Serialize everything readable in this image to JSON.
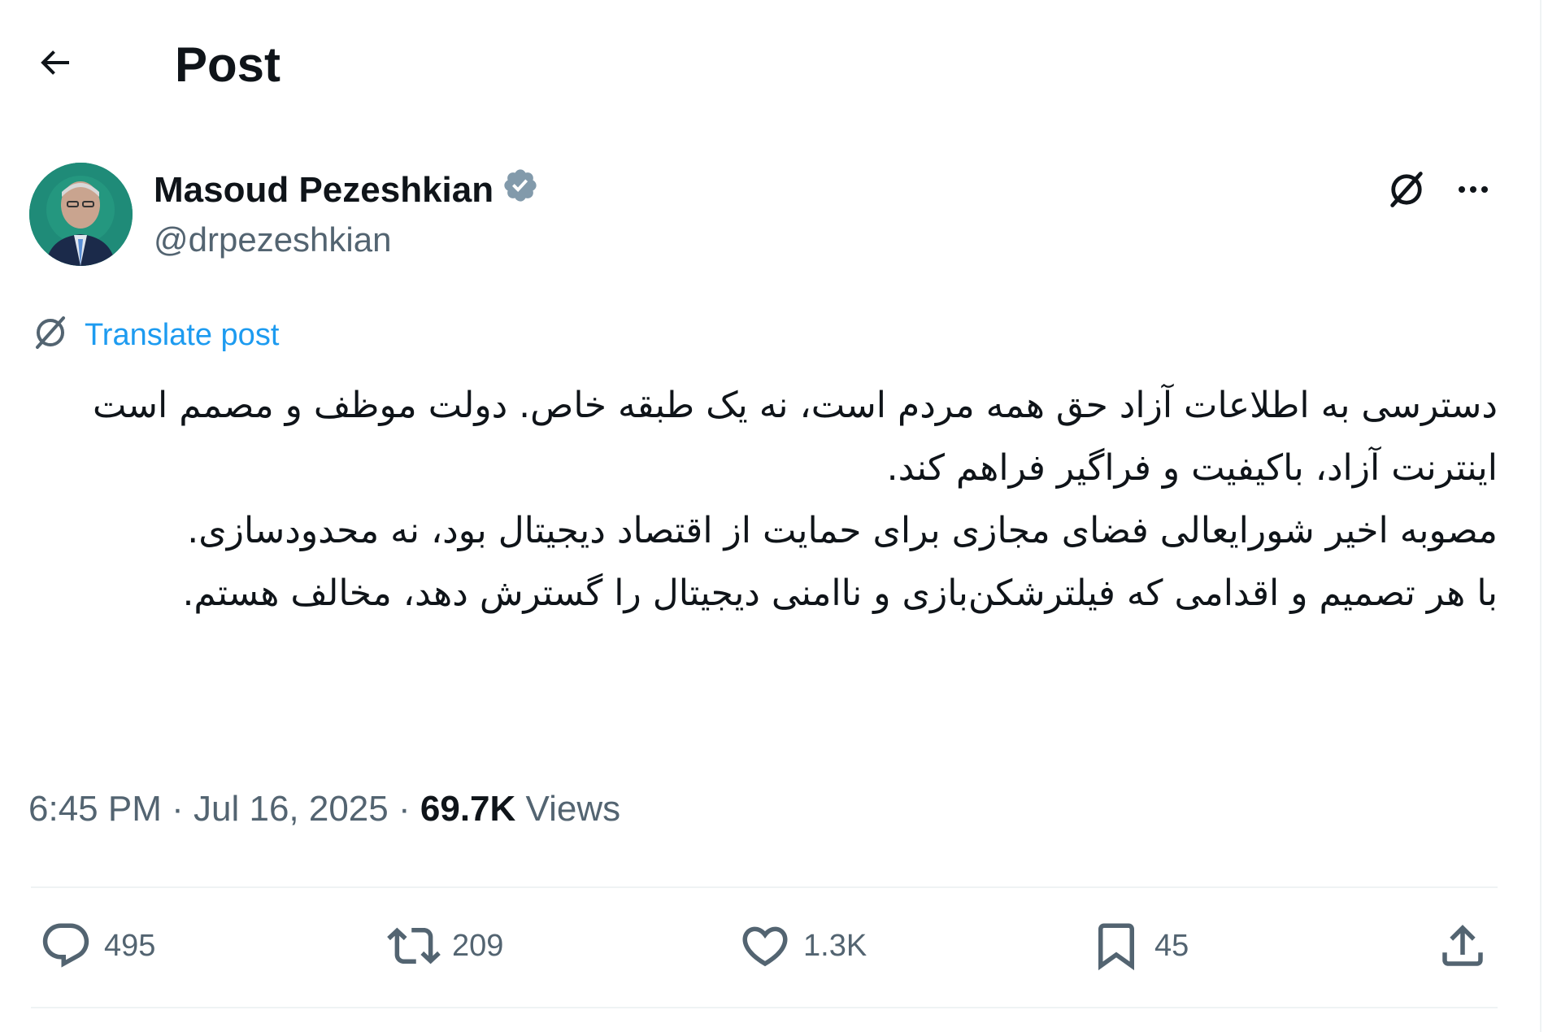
{
  "header": {
    "back_icon": "arrow-left-icon",
    "title": "Post"
  },
  "author": {
    "display_name": "Masoud Pezeshkian",
    "verified_icon": "verified-badge-icon",
    "verified_color": "#829aab",
    "handle": "@drpezeshkian"
  },
  "top_actions": {
    "grok_icon": "grok-icon",
    "more_icon": "more-horizontal-icon"
  },
  "translate": {
    "icon": "grok-icon",
    "label": "Translate post",
    "color": "#1d9bf0"
  },
  "post": {
    "paragraphs": [
      "دسترسی به اطلاعات آزاد حق همه مردم است، نه یک طبقه خاص. دولت موظف و مصمم است اینترنت آزاد، باکیفیت و فراگیر فراهم کند.",
      "مصوبه اخیر شورایعالی فضای مجازی برای حمایت از اقتصاد دیجیتال بود، نه محدودسازی.",
      "با هر تصمیم و اقدامی که فیلترشکن‌بازی و ناامنی دیجیتال را گسترش دهد، مخالف هستم."
    ]
  },
  "meta": {
    "time": "6:45 PM",
    "separator": "·",
    "date": "Jul 16, 2025",
    "views_count": "69.7K",
    "views_label": "Views"
  },
  "actions": {
    "replies": {
      "icon": "reply-icon",
      "count": "495"
    },
    "reposts": {
      "icon": "repost-icon",
      "count": "209"
    },
    "likes": {
      "icon": "heart-icon",
      "count": "1.3K"
    },
    "bookmarks": {
      "icon": "bookmark-icon",
      "count": "45"
    },
    "share": {
      "icon": "share-icon"
    }
  },
  "colors": {
    "text": "#0f1419",
    "secondary": "#536471",
    "divider": "#eff3f4"
  }
}
